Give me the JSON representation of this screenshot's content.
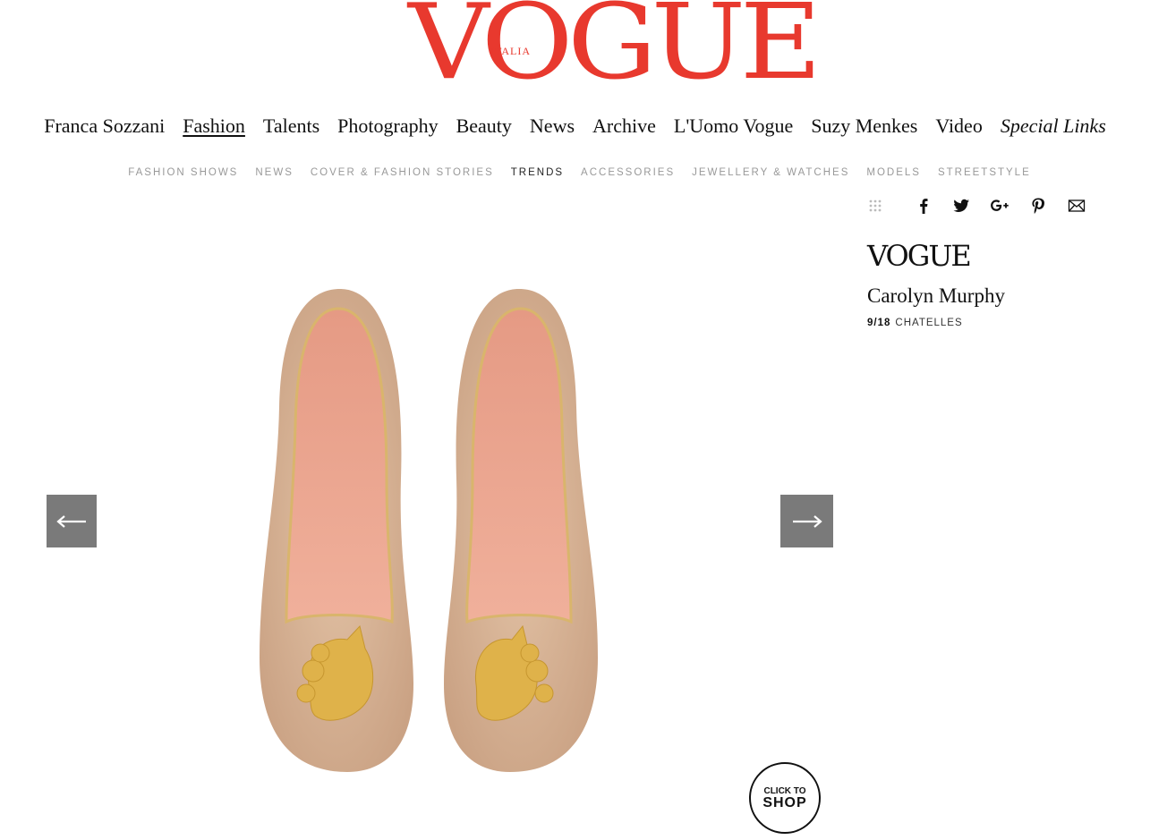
{
  "brand": {
    "logo_text": "VOGUE",
    "logo_subtext": "ITALIA",
    "accent_color": "#e8392e"
  },
  "main_nav": [
    {
      "label": "Franca Sozzani",
      "active": false
    },
    {
      "label": "Fashion",
      "active": true
    },
    {
      "label": "Talents",
      "active": false
    },
    {
      "label": "Photography",
      "active": false
    },
    {
      "label": "Beauty",
      "active": false
    },
    {
      "label": "News",
      "active": false
    },
    {
      "label": "Archive",
      "active": false
    },
    {
      "label": "L'Uomo Vogue",
      "active": false
    },
    {
      "label": "Suzy Menkes",
      "active": false
    },
    {
      "label": "Video",
      "active": false
    },
    {
      "label": "Special Links",
      "active": false
    }
  ],
  "sub_nav": [
    {
      "label": "FASHION SHOWS",
      "active": false
    },
    {
      "label": "NEWS",
      "active": false
    },
    {
      "label": "COVER & FASHION STORIES",
      "active": false
    },
    {
      "label": "TRENDS",
      "active": true
    },
    {
      "label": "ACCESSORIES",
      "active": false
    },
    {
      "label": "JEWELLERY & WATCHES",
      "active": false
    },
    {
      "label": "MODELS",
      "active": false
    },
    {
      "label": "STREETSTYLE",
      "active": false
    }
  ],
  "share_icons": [
    "grid-icon",
    "facebook-icon",
    "twitter-icon",
    "google-plus-icon",
    "pinterest-icon",
    "email-icon"
  ],
  "sidebar": {
    "logo_text": "VOGUE",
    "title": "Carolyn Murphy",
    "counter": "9/18",
    "caption": "CHATELLES"
  },
  "shop_badge": {
    "line1": "CLICK TO",
    "line2": "SHOP"
  }
}
